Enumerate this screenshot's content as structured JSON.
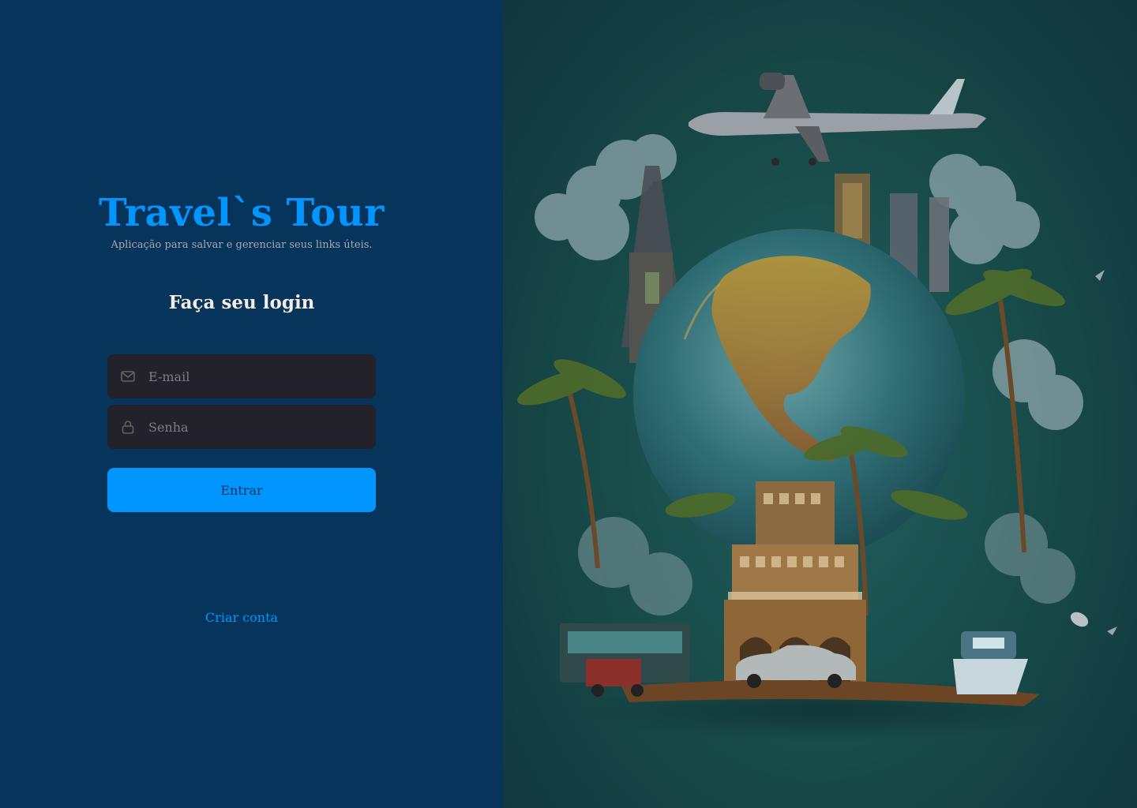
{
  "brand": {
    "title": "Travel`s Tour",
    "subtitle": "Aplicação para salvar e gerenciar seus links úteis."
  },
  "login": {
    "heading": "Faça seu login",
    "email": {
      "placeholder": "E-mail",
      "value": "",
      "icon": "mail-icon"
    },
    "password": {
      "placeholder": "Senha",
      "value": "",
      "icon": "lock-icon"
    },
    "submit_label": "Entrar",
    "create_account_label": "Criar conta"
  },
  "hero": {
    "description_icon": "travel-illustration"
  },
  "colors": {
    "left_background": "#06345a",
    "accent": "#0095ff",
    "input_background": "#232129",
    "subtitle_text": "#a8a8b3",
    "heading_text": "#f4ede8",
    "input_icon": "#666360",
    "button_text": "#06345a"
  }
}
